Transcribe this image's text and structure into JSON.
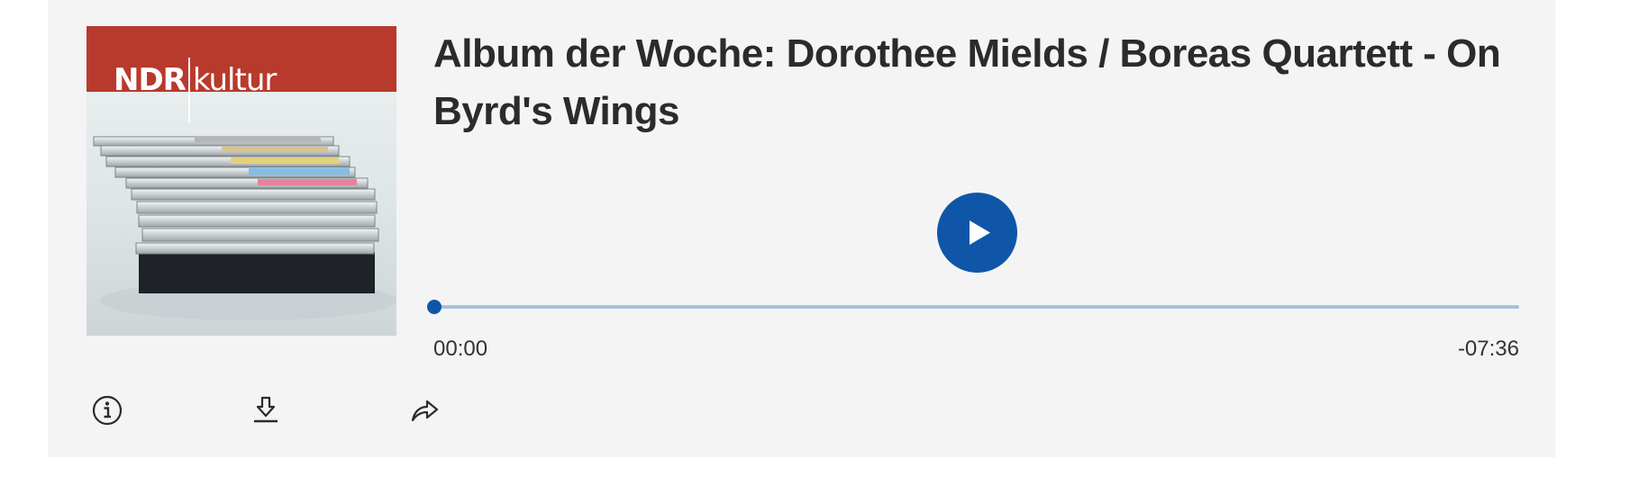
{
  "episode": {
    "title": "Album der Woche: Dorothee Mields / Boreas Quartett - On Byrd's Wings"
  },
  "cover": {
    "logo_brand": "NDR",
    "logo_channel": "kultur",
    "banner_color": "#b83a2c"
  },
  "player": {
    "play_icon": "play-icon",
    "elapsed": "00:00",
    "remaining": "-07:36",
    "progress": 0,
    "accent_color": "#0f56a8"
  },
  "actions": {
    "info_icon": "info-icon",
    "download_icon": "download-icon",
    "share_icon": "share-icon"
  }
}
